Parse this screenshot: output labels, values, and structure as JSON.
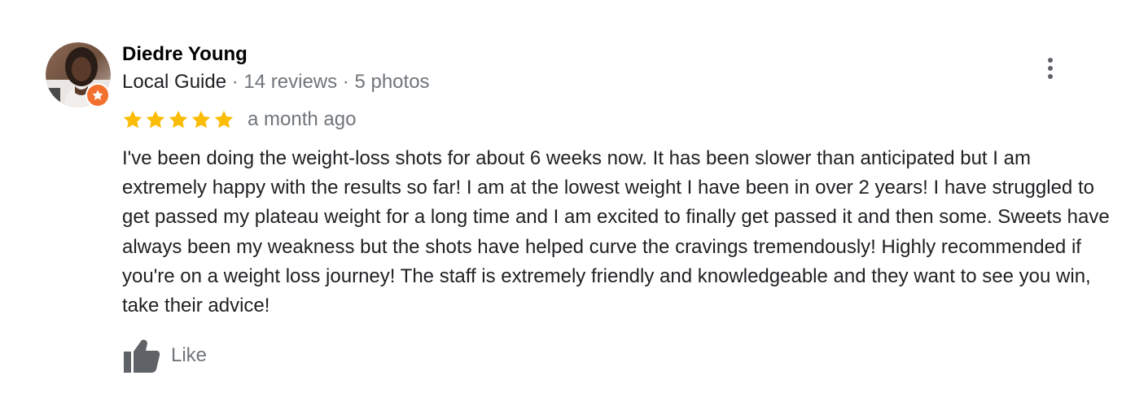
{
  "review": {
    "author": {
      "name": "Diedre Young",
      "guide_label": "Local Guide",
      "reviews_count": "14 reviews",
      "photos_count": "5 photos",
      "separator": " · "
    },
    "rating": {
      "stars": 5,
      "max": 5,
      "star_color": "#fbbc04"
    },
    "date": "a month ago",
    "text": "I've been doing the weight-loss shots for about 6 weeks now. It has been slower than anticipated but I am extremely happy with the results so far! I am at the lowest weight I have been in over 2 years! I have struggled to get passed my plateau weight for a long time and I am excited to finally get passed it and then some. Sweets have always been my weakness but the shots have helped curve the cravings tremendously! Highly recommended if you're on a weight loss journey! The staff is extremely friendly and knowledgeable and they want to see you win, take their advice!",
    "actions": {
      "like_label": "Like"
    }
  },
  "icons": {
    "avatar": "avatar",
    "badge": "local-guide-star-icon",
    "menu": "more-vert-icon",
    "like": "thumbs-up-icon"
  },
  "colors": {
    "badge": "#f4702f",
    "muted_text": "#70757a",
    "icon_gray": "#5f6368"
  }
}
